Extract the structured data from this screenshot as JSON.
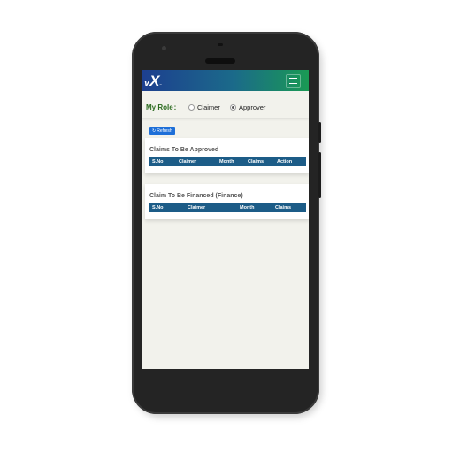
{
  "app": {
    "logo": {
      "main_v": "v",
      "main_x": "X",
      "sub": "~"
    },
    "menu_icon": "hamburger-icon",
    "colors": {
      "appbar_start": "#1d3f8f",
      "appbar_end": "#1a9a54",
      "table_header": "#1c5c87",
      "refresh_button": "#1e6fd8",
      "role_label": "#2b6b1f"
    }
  },
  "role": {
    "label": "My Role",
    "separator": ":",
    "options": [
      {
        "label": "Claimer",
        "selected": false
      },
      {
        "label": "Approver",
        "selected": true
      }
    ]
  },
  "refresh": {
    "label": "Refresh",
    "icon": "refresh-icon"
  },
  "claims_to_approve": {
    "title": "Claims To Be Approved",
    "columns": [
      "S.No",
      "Claimer",
      "Month",
      "Claims",
      "Action"
    ]
  },
  "claims_to_finance": {
    "title": "Claim To Be Financed (Finance)",
    "columns": [
      "S.No",
      "Claimer",
      "Month",
      "Claims"
    ]
  }
}
